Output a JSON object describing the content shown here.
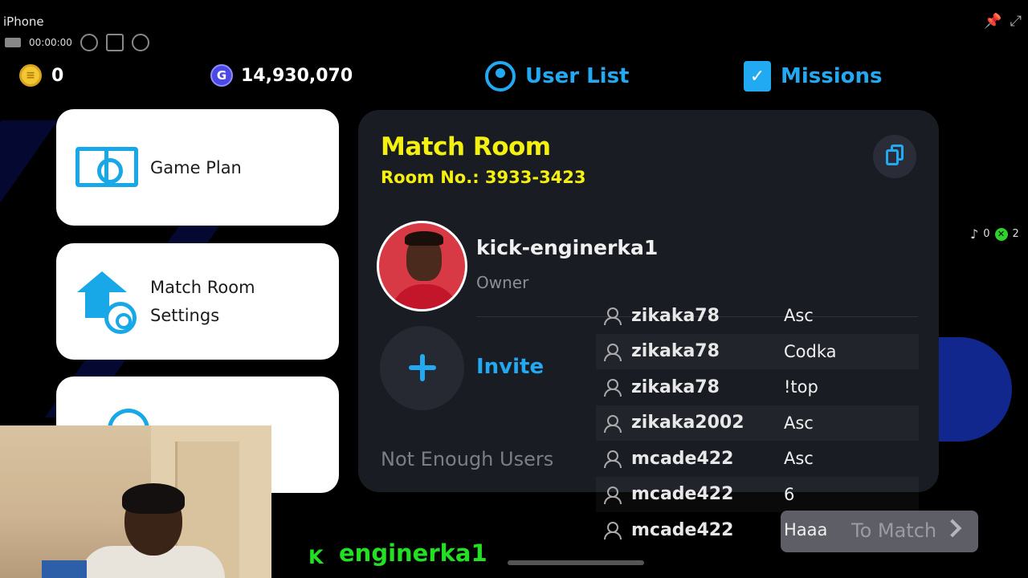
{
  "recorder": {
    "device": "iPhone",
    "timer": "00:00:00"
  },
  "currency": {
    "coins": "0",
    "gp": "14,930,070",
    "gp_icon_letter": "G"
  },
  "nav": {
    "user_list": "User List",
    "missions": "Missions"
  },
  "menu": {
    "game_plan": "Game Plan",
    "match_room_settings_line1": "Match Room",
    "match_room_settings_line2": "Settings"
  },
  "room": {
    "title": "Match Room",
    "room_no": "Room No.: 3933-3423",
    "owner_name": "kick-enginerka1",
    "owner_role": "Owner",
    "invite": "Invite",
    "status": "Not Enough Users"
  },
  "chat": [
    {
      "user": "zikaka78",
      "message": "Asc"
    },
    {
      "user": "zikaka78",
      "message": "Codka"
    },
    {
      "user": "zikaka78",
      "message": "!top"
    },
    {
      "user": "zikaka2002",
      "message": "Asc"
    },
    {
      "user": "mcade422",
      "message": "Asc"
    },
    {
      "user": "mcade422",
      "message": "6"
    },
    {
      "user": "mcade422",
      "message": "Haaa"
    }
  ],
  "to_match": "To Match",
  "stream": {
    "tag_icon": "K",
    "streamer": "enginerka1",
    "tiktok_count": "0",
    "x_count": "2"
  },
  "colors": {
    "accent_blue": "#21a9f2",
    "title_yellow": "#f4f00f",
    "panel_bg": "#1a1c24",
    "tag_green": "#22e022"
  }
}
